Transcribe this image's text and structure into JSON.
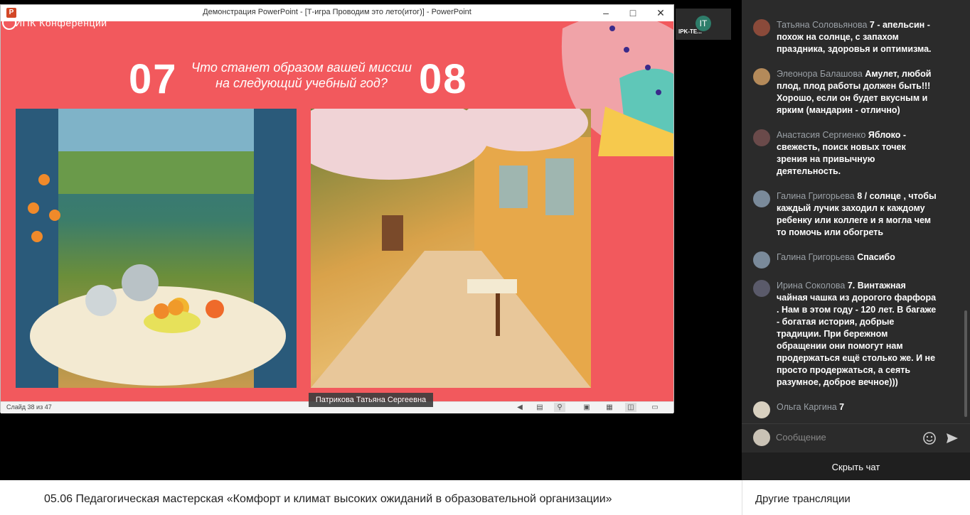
{
  "ppt_window": {
    "title": "Демонстрация PowerPoint - [Т-игра Проводим это лето(итог)] - PowerPoint",
    "app_icon": "P",
    "status": {
      "slide_counter": "Слайд 38 из 47"
    }
  },
  "slide": {
    "brand": "ИПК Конференции",
    "number_left": "07",
    "number_right": "08",
    "question": "Что станет образом вашей миссии на следующий учебный год?",
    "accent_color": "#f2595d"
  },
  "speaker_label": "Патрикова Татьяна Сергеевна",
  "participant": {
    "initials": "IT",
    "name": "IPK-TE..."
  },
  "stream_title": "05.06 Педагогическая мастерская «Комфорт и климат высоких ожиданий в образовательной организации»",
  "chat": {
    "messages": [
      {
        "author": "Татьяна Соловьянова",
        "text": "7 - апельсин - похож на солнце, с запахом праздника, здоровья и оптимизма.",
        "avatar_color": "#8a4a3a"
      },
      {
        "author": "Элеонора Балашова",
        "text": "Амулет, любой плод, плод работы должен быть!!! Хорошо, если он будет вкусным и ярким (мандарин - отлично)",
        "avatar_color": "#b48a5a"
      },
      {
        "author": "Анастасия Сергиенко",
        "text": "Яблоко - свежесть, поиск новых точек зрения на привычную деятельность.",
        "avatar_color": "#6a4a4a"
      },
      {
        "author": "Галина Григорьева",
        "text": "8 / солнце , чтобы каждый лучик заходил к каждому ребенку или коллеге и я могла чем то помочь или обогреть",
        "avatar_color": "#7a8a9a"
      },
      {
        "author": "Галина Григорьева",
        "text": "Спасибо",
        "avatar_color": "#7a8a9a"
      },
      {
        "author": "Ирина Соколова",
        "text": "7. Винтажная чайная чашка из дорогого фарфора . Нам в этом году - 120 лет. В багаже - богатая история, добрые традиции. При бережном обращении они помогут нам продержаться ещё столько же. И не просто продержаться, а сеять разумное, доброе вечное)))",
        "avatar_color": "#5a5a6a"
      },
      {
        "author": "Ольга Каргина",
        "text": "7",
        "avatar_color": "#d8d0c0"
      }
    ],
    "input_placeholder": "Сообщение",
    "hide_chat_label": "Скрыть чат",
    "other_streams_label": "Другие трансляции"
  }
}
